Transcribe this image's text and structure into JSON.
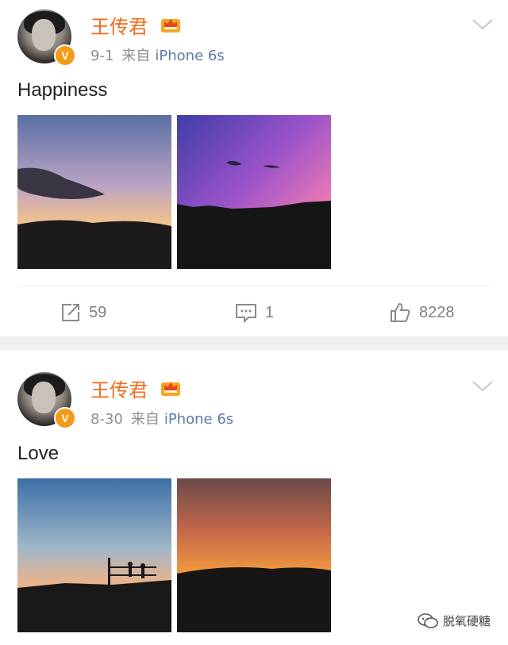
{
  "posts": [
    {
      "username": "王传君",
      "date": "9-1",
      "via": "来自",
      "source": "iPhone 6s",
      "text": "Happiness",
      "actions": {
        "repost": "59",
        "comment": "1",
        "like": "8228"
      }
    },
    {
      "username": "王传君",
      "date": "8-30",
      "via": "来自",
      "source": "iPhone 6s",
      "text": "Love"
    }
  ],
  "watermark": {
    "label": "脱氧硬糖",
    "icon": "wechat-icon"
  },
  "colors": {
    "username": "#f36a17",
    "source": "#5d7ba8",
    "badge": "#f39a17",
    "meta": "#8d8d8d"
  },
  "icons": {
    "verified": "verified-v-icon",
    "member": "crown-icon",
    "menu": "chevron-down-icon",
    "repost": "repost-icon",
    "comment": "comment-icon",
    "like": "thumbs-up-icon"
  }
}
